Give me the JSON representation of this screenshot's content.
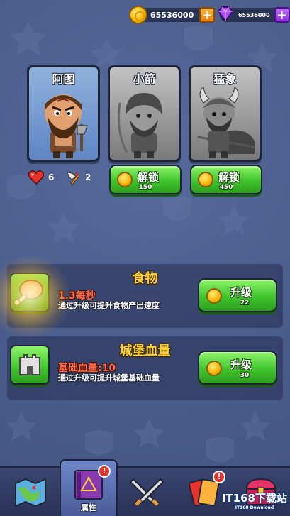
{
  "currency": {
    "coins": "65536000",
    "gems": "65536000",
    "coin_icon": "gold-coin-icon",
    "gem_icon": "purple-gem-icon",
    "plus_label": "+"
  },
  "heroes": [
    {
      "name": "阿图",
      "state": "unlocked"
    },
    {
      "name": "小箭",
      "state": "locked",
      "unlock_label": "解锁",
      "cost": "150"
    },
    {
      "name": "猛象",
      "state": "locked",
      "unlock_label": "解锁",
      "cost": "450"
    }
  ],
  "hero_stats": {
    "lives": "6",
    "attack": "2",
    "lives_icon": "heart-icon",
    "attack_icon": "winged-sword-icon"
  },
  "upgrades": [
    {
      "title": "食物",
      "value": "1.3每秒",
      "description": "通过升级可提升食物产出速度",
      "button_label": "升级",
      "cost": "22",
      "icon": "meat-icon"
    },
    {
      "title": "城堡血量",
      "value": "基础血量:10",
      "description": "通过升级可提升城堡基础血量",
      "button_label": "升级",
      "cost": "30",
      "icon": "castle-icon"
    }
  ],
  "nav": {
    "items": [
      {
        "icon": "map-icon",
        "label": ""
      },
      {
        "icon": "spellbook-icon",
        "label": "属性",
        "badge": "!"
      },
      {
        "icon": "crossed-swords-icon",
        "label": ""
      },
      {
        "icon": "cards-icon",
        "label": "",
        "badge": "!"
      },
      {
        "icon": "treasure-chest-icon",
        "label": ""
      }
    ]
  },
  "watermark": {
    "text": "IT168",
    "suffix": "下载站",
    "sub": "IT168 Download"
  },
  "colors": {
    "background": "#4a5d8c",
    "button_green": "#3fc52c",
    "title_gold": "#ffd23a",
    "value_red": "#ff6a4a"
  }
}
